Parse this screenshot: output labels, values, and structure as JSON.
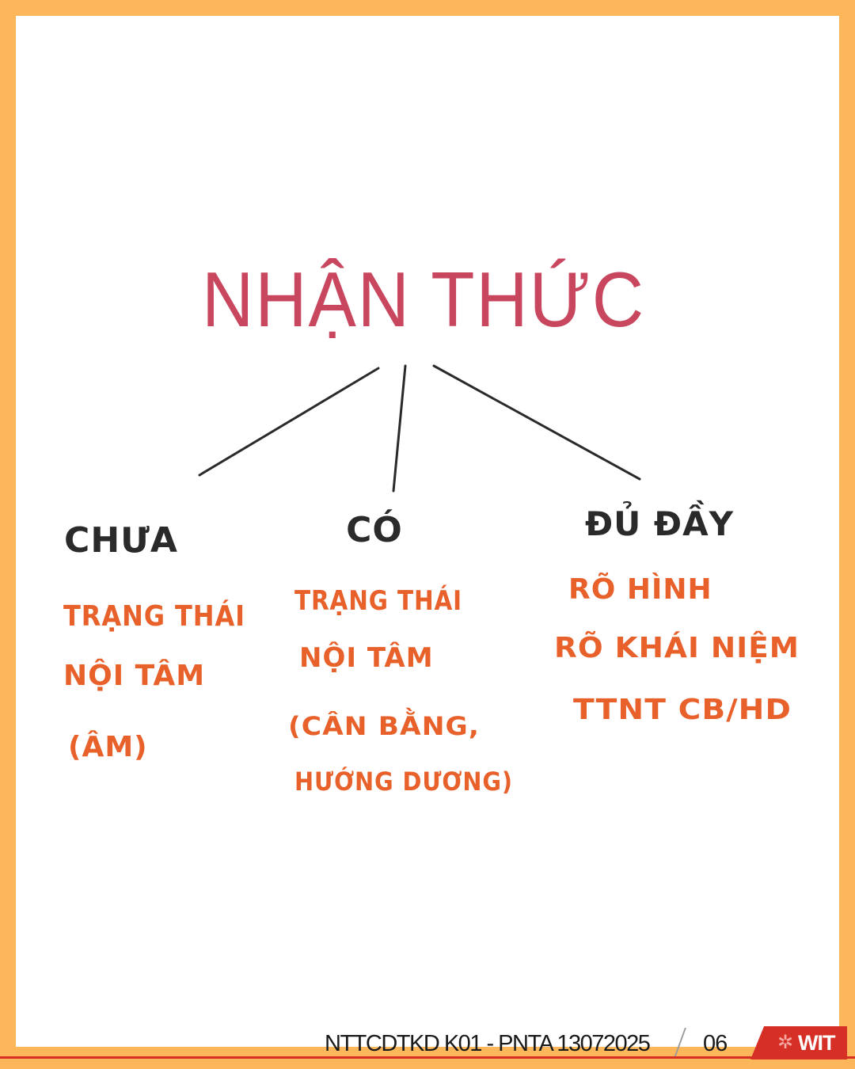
{
  "diagram": {
    "root": "NHẬN THỨC",
    "branches": [
      {
        "label": "CHƯA",
        "lines": [
          "TRẠNG THÁI",
          "NỘI TÂM",
          "(ÂM)"
        ]
      },
      {
        "label": "CÓ",
        "lines": [
          "TRẠNG THÁI",
          "NỘI TÂM",
          "(CÂN BẰNG,",
          "HƯỚNG DƯƠNG)"
        ]
      },
      {
        "label": "ĐỦ ĐẦY",
        "lines": [
          "RÕ HÌNH",
          "RÕ KHÁI NIỆM",
          "TTNT CB/HD"
        ]
      }
    ]
  },
  "footer": {
    "label": "NTTCDTKD K01 - PNTA  13072025",
    "page": "06",
    "logo": "WIT"
  },
  "colors": {
    "background": "#fdb75a",
    "root": "#c8465e",
    "branch": "#2a2a2a",
    "detail": "#e8602a",
    "accent": "#d62f26"
  }
}
